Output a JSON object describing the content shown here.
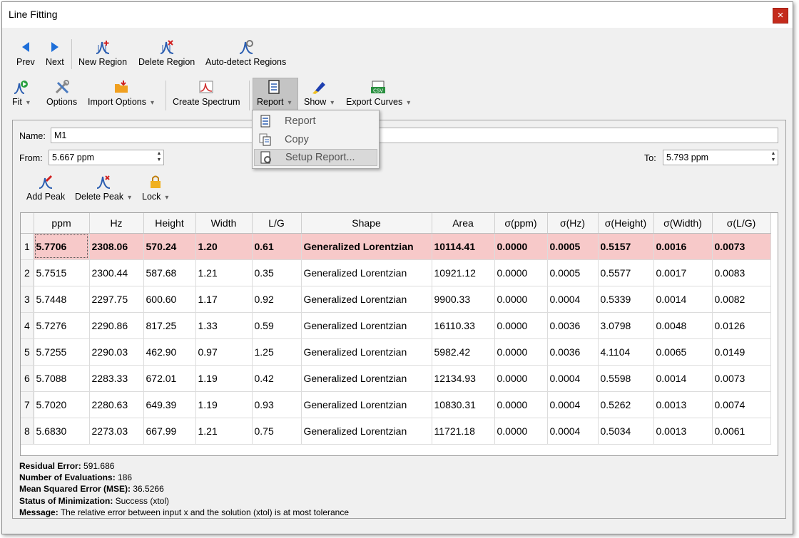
{
  "window": {
    "title": "Line Fitting",
    "close_label": "×"
  },
  "toolbar1": {
    "prev": "Prev",
    "next": "Next",
    "new_region": "New Region",
    "delete_region": "Delete Region",
    "auto_detect": "Auto-detect Regions"
  },
  "toolbar2": {
    "fit": "Fit",
    "options": "Options",
    "import_options": "Import Options",
    "create_spectrum": "Create Spectrum",
    "report": "Report",
    "show": "Show",
    "export_curves": "Export Curves"
  },
  "report_menu": {
    "items": [
      "Report",
      "Copy",
      "Setup Report..."
    ]
  },
  "form": {
    "name_label": "Name:",
    "name_value": "M1",
    "from_label": "From:",
    "from_value": "5.667 ppm",
    "to_label": "To:",
    "to_value": "5.793 ppm"
  },
  "peak_toolbar": {
    "add_peak": "Add Peak",
    "delete_peak": "Delete Peak",
    "lock": "Lock"
  },
  "table": {
    "headers": [
      "ppm",
      "Hz",
      "Height",
      "Width",
      "L/G",
      "Shape",
      "Area",
      "σ(ppm)",
      "σ(Hz)",
      "σ(Height)",
      "σ(Width)",
      "σ(L/G)"
    ],
    "rows": [
      {
        "n": "1",
        "c": [
          "5.7706",
          "2308.06",
          "570.24",
          "1.20",
          "0.61",
          "Generalized Lorentzian",
          "10114.41",
          "0.0000",
          "0.0005",
          "0.5157",
          "0.0016",
          "0.0073"
        ]
      },
      {
        "n": "2",
        "c": [
          "5.7515",
          "2300.44",
          "587.68",
          "1.21",
          "0.35",
          "Generalized Lorentzian",
          "10921.12",
          "0.0000",
          "0.0005",
          "0.5577",
          "0.0017",
          "0.0083"
        ]
      },
      {
        "n": "3",
        "c": [
          "5.7448",
          "2297.75",
          "600.60",
          "1.17",
          "0.92",
          "Generalized Lorentzian",
          "9900.33",
          "0.0000",
          "0.0004",
          "0.5339",
          "0.0014",
          "0.0082"
        ]
      },
      {
        "n": "4",
        "c": [
          "5.7276",
          "2290.86",
          "817.25",
          "1.33",
          "0.59",
          "Generalized Lorentzian",
          "16110.33",
          "0.0000",
          "0.0036",
          "3.0798",
          "0.0048",
          "0.0126"
        ]
      },
      {
        "n": "5",
        "c": [
          "5.7255",
          "2290.03",
          "462.90",
          "0.97",
          "1.25",
          "Generalized Lorentzian",
          "5982.42",
          "0.0000",
          "0.0036",
          "4.1104",
          "0.0065",
          "0.0149"
        ]
      },
      {
        "n": "6",
        "c": [
          "5.7088",
          "2283.33",
          "672.01",
          "1.19",
          "0.42",
          "Generalized Lorentzian",
          "12134.93",
          "0.0000",
          "0.0004",
          "0.5598",
          "0.0014",
          "0.0073"
        ]
      },
      {
        "n": "7",
        "c": [
          "5.7020",
          "2280.63",
          "649.39",
          "1.19",
          "0.93",
          "Generalized Lorentzian",
          "10830.31",
          "0.0000",
          "0.0004",
          "0.5262",
          "0.0013",
          "0.0074"
        ]
      },
      {
        "n": "8",
        "c": [
          "5.6830",
          "2273.03",
          "667.99",
          "1.21",
          "0.75",
          "Generalized Lorentzian",
          "11721.18",
          "0.0000",
          "0.0004",
          "0.5034",
          "0.0013",
          "0.0061"
        ]
      }
    ]
  },
  "status": {
    "residual_label": "Residual Error:",
    "residual_value": " 591.686",
    "evals_label": "Number of Evaluations:",
    "evals_value": " 186",
    "mse_label": "Mean Squared Error (MSE):",
    "mse_value": " 36.5266",
    "min_label": "Status of Minimization:",
    "min_value": " Success (xtol)",
    "msg_label": "Message:",
    "msg_value": " The relative error between input x and the solution (xtol) is at most tolerance"
  },
  "colors": {
    "selected_row": "#f7c9c9",
    "close_button": "#c42b1c",
    "accent_blue": "#1e6fd9"
  }
}
